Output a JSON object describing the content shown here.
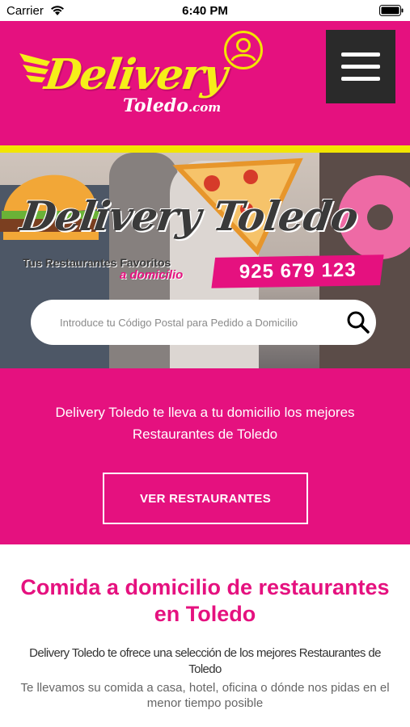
{
  "status_bar": {
    "carrier": "Carrier",
    "time": "6:40 PM"
  },
  "header": {
    "logo_word": "Delivery",
    "logo_sub": "Toledo",
    "logo_sub_suffix": ".com",
    "user_icon": "user-circle-icon",
    "menu_icon": "hamburger-menu-icon",
    "brand_pink": "#e5117f",
    "brand_yellow": "#f2e500"
  },
  "hero": {
    "title": "Delivery Toledo",
    "tagline": "Tus Restaurantes Favoritos",
    "tagline_accent": "a domicilio",
    "phone": "925 679 123",
    "search_placeholder": "Introduce tu Código Postal para Pedido a Domicilio"
  },
  "cta": {
    "text": "Delivery Toledo te lleva a tu domicilio los mejores Restaurantes de Toledo",
    "button_label": "VER RESTAURANTES"
  },
  "info": {
    "title": "Comida a domicilio de restaurantes en Toledo",
    "lead": "Delivery Toledo te ofrece una selección de los mejores Restaurantes de Toledo",
    "body": "Te llevamos su comida a casa, hotel, oficina o dónde nos pidas en el menor tiempo posible"
  }
}
